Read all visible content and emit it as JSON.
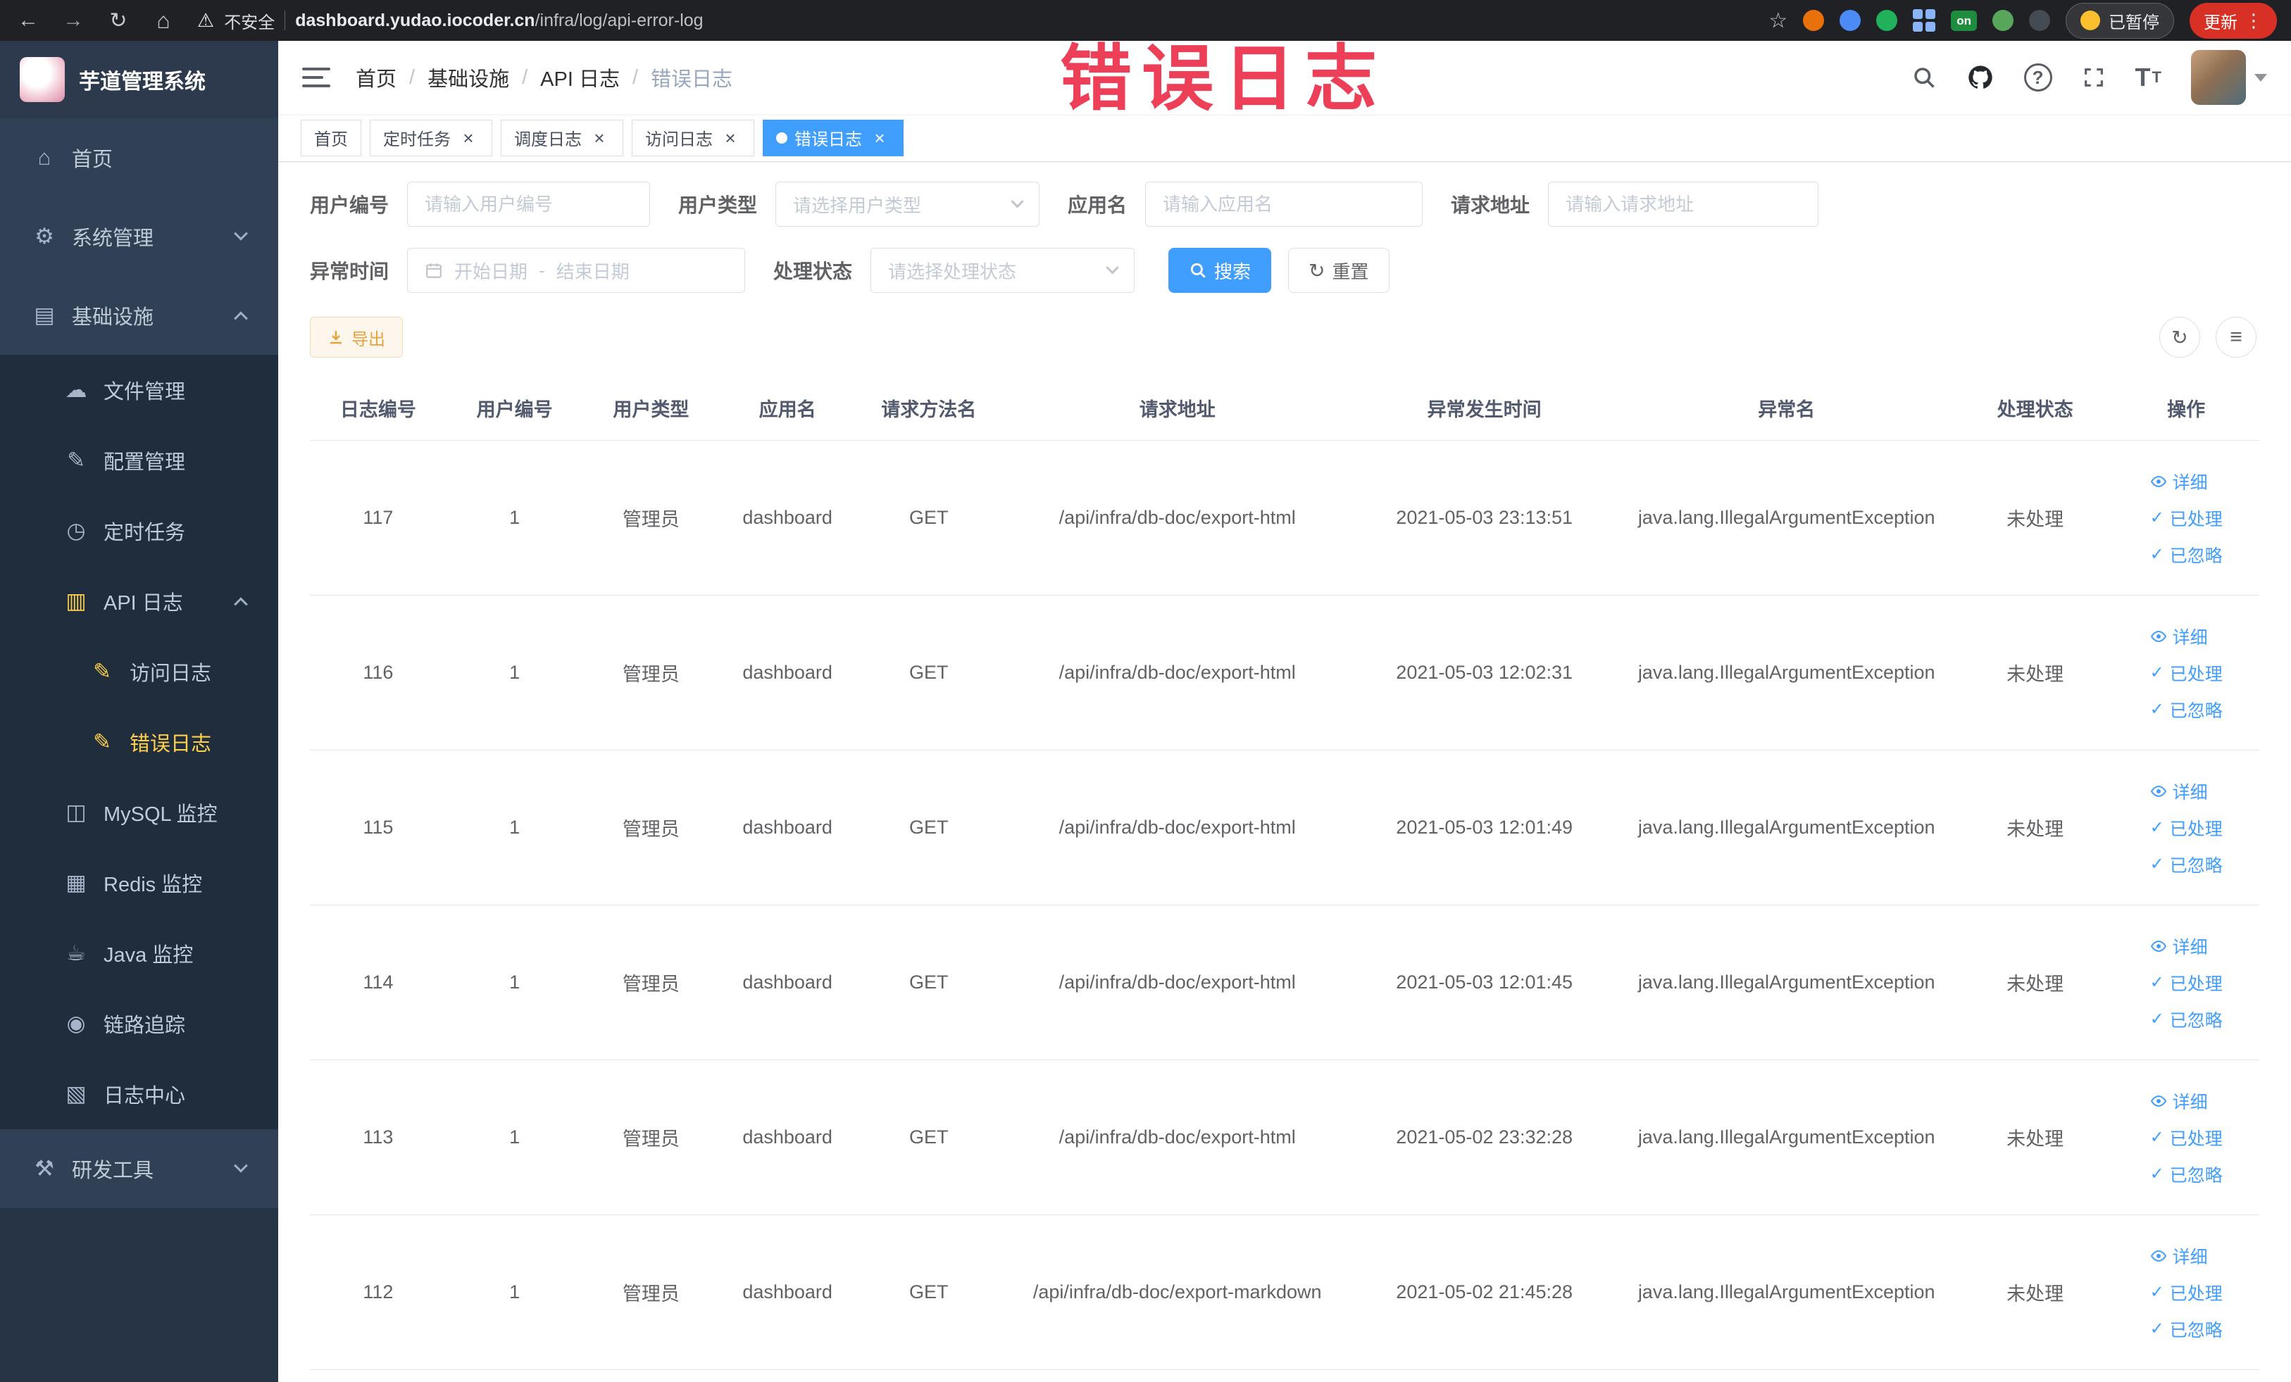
{
  "colors": {
    "accent": "#409eff",
    "sidebar_bg": "#304156",
    "submenu_bg": "#1f2d3d",
    "active_menu_text": "#ffd04b",
    "warning_button_text": "#e6a23c",
    "watermark": "#ee3f58"
  },
  "annotation": {
    "text": "错误日志"
  },
  "browser": {
    "security_label": "不安全",
    "url_domain": "dashboard.yudao.iocoder.cn",
    "url_path": "/infra/log/api-error-log",
    "extension_badge": "on",
    "paused_badge": "已暂停",
    "update_label": "更新"
  },
  "sidebar": {
    "logo_title": "芋道管理系统",
    "items": [
      {
        "label": "首页",
        "icon": "home-icon",
        "glyph": "⌂",
        "level": 1
      },
      {
        "label": "系统管理",
        "icon": "gear-icon",
        "glyph": "⚙",
        "level": 1,
        "arrow": "down"
      },
      {
        "label": "基础设施",
        "icon": "infrastructure-icon",
        "glyph": "▤",
        "level": 1,
        "arrow": "up"
      },
      {
        "label": "文件管理",
        "icon": "file-manage-icon",
        "glyph": "☁",
        "level": 2
      },
      {
        "label": "配置管理",
        "icon": "config-manage-icon",
        "glyph": "✎",
        "level": 2
      },
      {
        "label": "定时任务",
        "icon": "schedule-job-icon",
        "glyph": "◷",
        "level": 2
      },
      {
        "label": "API 日志",
        "icon": "api-log-icon",
        "glyph": "▥",
        "level": 2,
        "arrow": "up",
        "icon_yellow": true
      },
      {
        "label": "访问日志",
        "icon": "access-log-icon",
        "glyph": "✎",
        "level": 3,
        "icon_yellow": true
      },
      {
        "label": "错误日志",
        "icon": "error-log-icon",
        "glyph": "✎",
        "level": 3,
        "icon_yellow": true,
        "active": true
      },
      {
        "label": "MySQL 监控",
        "icon": "mysql-monitor-icon",
        "glyph": "◫",
        "level": 2
      },
      {
        "label": "Redis 监控",
        "icon": "redis-monitor-icon",
        "glyph": "▦",
        "level": 2
      },
      {
        "label": "Java 监控",
        "icon": "java-monitor-icon",
        "glyph": "☕",
        "level": 2
      },
      {
        "label": "链路追踪",
        "icon": "trace-icon",
        "glyph": "◉",
        "level": 2
      },
      {
        "label": "日志中心",
        "icon": "log-center-icon",
        "glyph": "▧",
        "level": 2
      },
      {
        "label": "研发工具",
        "icon": "dev-tools-icon",
        "glyph": "⚒",
        "level": 1,
        "arrow": "down"
      }
    ]
  },
  "breadcrumb": [
    "首页",
    "基础设施",
    "API 日志",
    "错误日志"
  ],
  "ui": {
    "breadcrumb_separator": "/"
  },
  "tabs": [
    {
      "label": "首页",
      "closable": false,
      "active": false
    },
    {
      "label": "定时任务",
      "closable": true,
      "active": false
    },
    {
      "label": "调度日志",
      "closable": true,
      "active": false
    },
    {
      "label": "访问日志",
      "closable": true,
      "active": false
    },
    {
      "label": "错误日志",
      "closable": true,
      "active": true
    }
  ],
  "filters": {
    "user_id": {
      "label": "用户编号",
      "placeholder": "请输入用户编号"
    },
    "user_type": {
      "label": "用户类型",
      "placeholder": "请选择用户类型"
    },
    "app_name": {
      "label": "应用名",
      "placeholder": "请输入应用名"
    },
    "request_url": {
      "label": "请求地址",
      "placeholder": "请输入请求地址"
    },
    "exception_time": {
      "label": "异常时间",
      "start_placeholder": "开始日期",
      "end_placeholder": "结束日期",
      "separator": "-"
    },
    "process_status": {
      "label": "处理状态",
      "placeholder": "请选择处理状态"
    },
    "search_label": "搜索",
    "reset_label": "重置"
  },
  "toolbar": {
    "export_label": "导出"
  },
  "table": {
    "columns": [
      "日志编号",
      "用户编号",
      "用户类型",
      "应用名",
      "请求方法名",
      "请求地址",
      "异常发生时间",
      "异常名",
      "处理状态",
      "操作"
    ],
    "actions": {
      "detail": "详细",
      "processed": "已处理",
      "ignored": "已忽略"
    },
    "rows": [
      {
        "log_id": "117",
        "user_id": "1",
        "user_type": "管理员",
        "app_name": "dashboard",
        "method": "GET",
        "url": "/api/infra/db-doc/export-html",
        "time": "2021-05-03 23:13:51",
        "exception": "java.lang.IllegalArgumentException",
        "status": "未处理"
      },
      {
        "log_id": "116",
        "user_id": "1",
        "user_type": "管理员",
        "app_name": "dashboard",
        "method": "GET",
        "url": "/api/infra/db-doc/export-html",
        "time": "2021-05-03 12:02:31",
        "exception": "java.lang.IllegalArgumentException",
        "status": "未处理"
      },
      {
        "log_id": "115",
        "user_id": "1",
        "user_type": "管理员",
        "app_name": "dashboard",
        "method": "GET",
        "url": "/api/infra/db-doc/export-html",
        "time": "2021-05-03 12:01:49",
        "exception": "java.lang.IllegalArgumentException",
        "status": "未处理"
      },
      {
        "log_id": "114",
        "user_id": "1",
        "user_type": "管理员",
        "app_name": "dashboard",
        "method": "GET",
        "url": "/api/infra/db-doc/export-html",
        "time": "2021-05-03 12:01:45",
        "exception": "java.lang.IllegalArgumentException",
        "status": "未处理"
      },
      {
        "log_id": "113",
        "user_id": "1",
        "user_type": "管理员",
        "app_name": "dashboard",
        "method": "GET",
        "url": "/api/infra/db-doc/export-html",
        "time": "2021-05-02 23:32:28",
        "exception": "java.lang.IllegalArgumentException",
        "status": "未处理"
      },
      {
        "log_id": "112",
        "user_id": "1",
        "user_type": "管理员",
        "app_name": "dashboard",
        "method": "GET",
        "url": "/api/infra/db-doc/export-markdown",
        "time": "2021-05-02 21:45:28",
        "exception": "java.lang.IllegalArgumentException",
        "status": "未处理"
      }
    ]
  }
}
